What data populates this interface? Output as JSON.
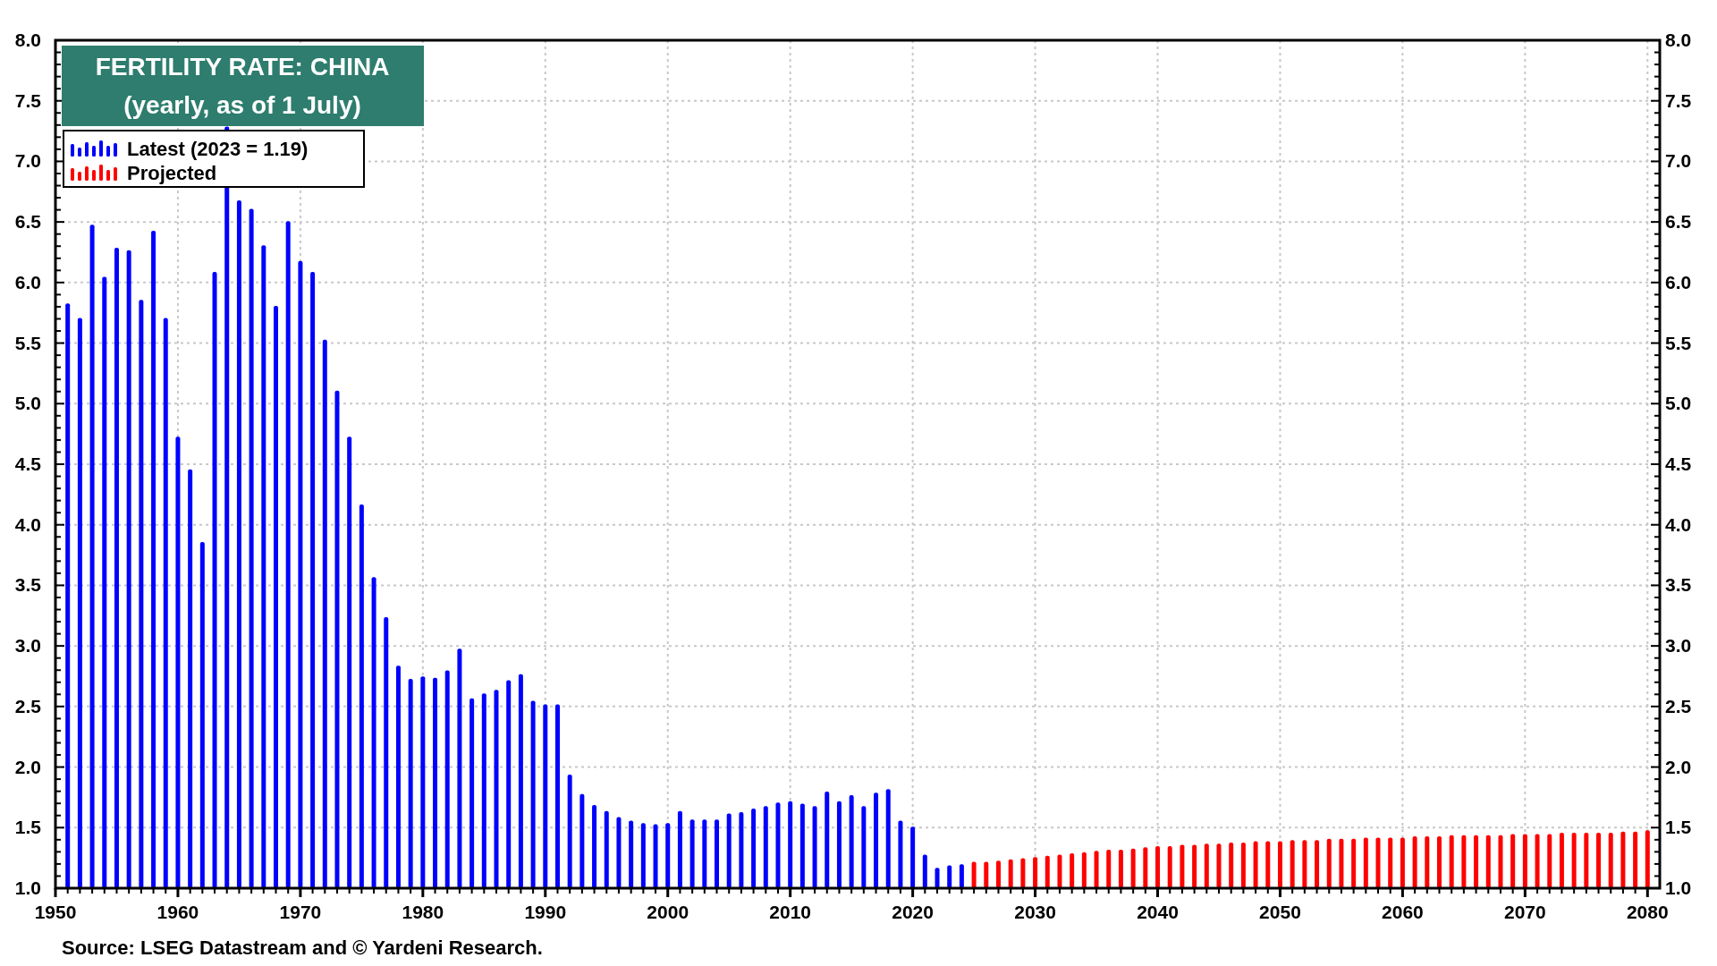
{
  "chart_data": {
    "type": "bar",
    "title": "FERTILITY RATE: CHINA",
    "subtitle": "(yearly, as of 1 July)",
    "x": [
      1951,
      1952,
      1953,
      1954,
      1955,
      1956,
      1957,
      1958,
      1959,
      1960,
      1961,
      1962,
      1963,
      1964,
      1965,
      1966,
      1967,
      1968,
      1969,
      1970,
      1971,
      1972,
      1973,
      1974,
      1975,
      1976,
      1977,
      1978,
      1979,
      1980,
      1981,
      1982,
      1983,
      1984,
      1985,
      1986,
      1987,
      1988,
      1989,
      1990,
      1991,
      1992,
      1993,
      1994,
      1995,
      1996,
      1997,
      1998,
      1999,
      2000,
      2001,
      2002,
      2003,
      2004,
      2005,
      2006,
      2007,
      2008,
      2009,
      2010,
      2011,
      2012,
      2013,
      2014,
      2015,
      2016,
      2017,
      2018,
      2019,
      2020,
      2021,
      2022,
      2023,
      2024,
      2025,
      2026,
      2027,
      2028,
      2029,
      2030,
      2031,
      2032,
      2033,
      2034,
      2035,
      2036,
      2037,
      2038,
      2039,
      2040,
      2041,
      2042,
      2043,
      2044,
      2045,
      2046,
      2047,
      2048,
      2049,
      2050,
      2051,
      2052,
      2053,
      2054,
      2055,
      2056,
      2057,
      2058,
      2059,
      2060,
      2061,
      2062,
      2063,
      2064,
      2065,
      2066,
      2067,
      2068,
      2069,
      2070,
      2071,
      2072,
      2073,
      2074,
      2075,
      2076,
      2077,
      2078,
      2079,
      2080
    ],
    "series": [
      {
        "name": "Latest (2023 = 1.19)",
        "color": "#0000ff",
        "values": [
          5.82,
          5.7,
          6.47,
          6.04,
          6.28,
          6.26,
          5.85,
          6.42,
          5.7,
          4.72,
          4.45,
          3.85,
          6.08,
          7.28,
          6.67,
          6.6,
          6.3,
          5.8,
          6.5,
          6.17,
          6.08,
          5.52,
          5.1,
          4.72,
          4.16,
          3.56,
          3.23,
          2.83,
          2.72,
          2.74,
          2.73,
          2.79,
          2.97,
          2.56,
          2.6,
          2.63,
          2.71,
          2.76,
          2.54,
          2.51,
          2.51,
          1.93,
          1.77,
          1.68,
          1.63,
          1.58,
          1.55,
          1.53,
          1.52,
          1.53,
          1.63,
          1.56,
          1.56,
          1.56,
          1.61,
          1.62,
          1.65,
          1.67,
          1.7,
          1.71,
          1.69,
          1.67,
          1.79,
          1.71,
          1.76,
          1.67,
          1.78,
          1.81,
          1.55,
          1.5,
          1.27,
          1.16,
          1.18,
          1.19,
          null,
          null,
          null,
          null,
          null,
          null,
          null,
          null,
          null,
          null,
          null,
          null,
          null,
          null,
          null,
          null,
          null,
          null,
          null,
          null,
          null,
          null,
          null,
          null,
          null,
          null,
          null,
          null,
          null,
          null,
          null,
          null,
          null,
          null,
          null,
          null,
          null,
          null,
          null,
          null,
          null,
          null,
          null,
          null,
          null,
          null,
          null,
          null,
          null,
          null,
          null,
          null,
          null,
          null,
          null,
          null
        ]
      },
      {
        "name": "Projected",
        "color": "#ff0000",
        "values": [
          null,
          null,
          null,
          null,
          null,
          null,
          null,
          null,
          null,
          null,
          null,
          null,
          null,
          null,
          null,
          null,
          null,
          null,
          null,
          null,
          null,
          null,
          null,
          null,
          null,
          null,
          null,
          null,
          null,
          null,
          null,
          null,
          null,
          null,
          null,
          null,
          null,
          null,
          null,
          null,
          null,
          null,
          null,
          null,
          null,
          null,
          null,
          null,
          null,
          null,
          null,
          null,
          null,
          null,
          null,
          null,
          null,
          null,
          null,
          null,
          null,
          null,
          null,
          null,
          null,
          null,
          null,
          null,
          null,
          null,
          null,
          null,
          null,
          null,
          1.21,
          1.21,
          1.22,
          1.23,
          1.24,
          1.25,
          1.26,
          1.27,
          1.28,
          1.29,
          1.3,
          1.31,
          1.31,
          1.32,
          1.33,
          1.34,
          1.34,
          1.35,
          1.35,
          1.36,
          1.36,
          1.37,
          1.37,
          1.38,
          1.38,
          1.38,
          1.39,
          1.39,
          1.39,
          1.4,
          1.4,
          1.4,
          1.41,
          1.41,
          1.41,
          1.41,
          1.42,
          1.42,
          1.42,
          1.43,
          1.43,
          1.43,
          1.43,
          1.43,
          1.44,
          1.44,
          1.44,
          1.44,
          1.45,
          1.45,
          1.45,
          1.45,
          1.45,
          1.46,
          1.46,
          1.47
        ]
      }
    ],
    "xlim": [
      1950,
      2081
    ],
    "ylim": [
      1,
      8
    ],
    "grid": true,
    "legend": true,
    "xticks": [
      1950,
      1960,
      1970,
      1980,
      1990,
      2000,
      2010,
      2020,
      2030,
      2040,
      2050,
      2060,
      2070,
      2080
    ],
    "yticks": [
      {
        "value": 1,
        "label": "1.0"
      },
      {
        "value": 1.5,
        "label": "1.5"
      },
      {
        "value": 2,
        "label": "2.0"
      },
      {
        "value": 2.5,
        "label": "2.5"
      },
      {
        "value": 3,
        "label": "3.0"
      },
      {
        "value": 3.5,
        "label": "3.5"
      },
      {
        "value": 4,
        "label": "4.0"
      },
      {
        "value": 4.5,
        "label": "4.5"
      },
      {
        "value": 5,
        "label": "5.0"
      },
      {
        "value": 5.5,
        "label": "5.5"
      },
      {
        "value": 6,
        "label": "6.0"
      },
      {
        "value": 6.5,
        "label": "6.5"
      },
      {
        "value": 7,
        "label": "7.0"
      },
      {
        "value": 7.5,
        "label": "7.5"
      },
      {
        "value": 8,
        "label": "8.0"
      }
    ]
  },
  "source": "Source: LSEG Datastream and © Yardeni Research."
}
